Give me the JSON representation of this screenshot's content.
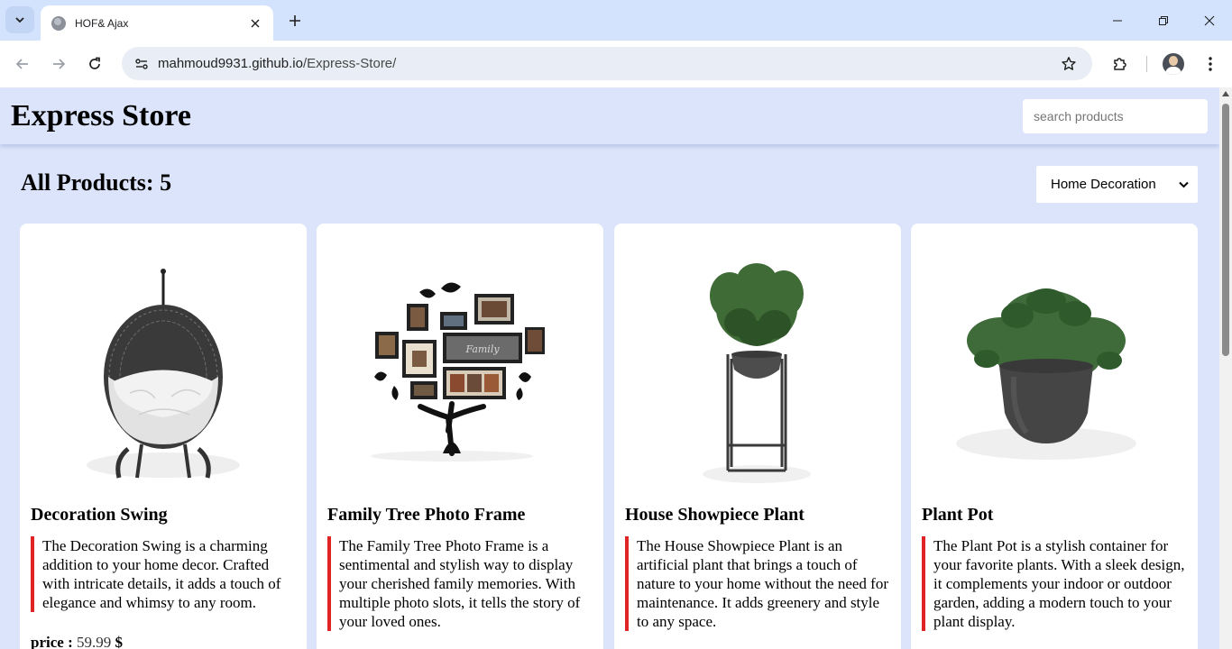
{
  "browser": {
    "tab": {
      "title": "HOF& Ajax"
    },
    "url": {
      "domain": "mahmoud9931.github.io",
      "path": "/Express-Store/"
    }
  },
  "header": {
    "title": "Express Store",
    "search_placeholder": "search products"
  },
  "products_section": {
    "heading": "All Products: 5",
    "filter_selected": "Home Decoration"
  },
  "products": [
    {
      "title": "Decoration Swing",
      "image_icon": "swing-chair-image",
      "description": "The Decoration Swing is a charming addition to your home decor. Crafted with intricate details, it adds a touch of elegance and whimsy to any room.",
      "price_label": "price :",
      "price_value": "59.99",
      "currency": "$"
    },
    {
      "title": "Family Tree Photo Frame",
      "image_icon": "family-tree-frame-image",
      "description": "The Family Tree Photo Frame is a sentimental and stylish way to display your cherished family memories. With multiple photo slots, it tells the story of your loved ones."
    },
    {
      "title": "House Showpiece Plant",
      "image_icon": "showpiece-plant-image",
      "description": "The House Showpiece Plant is an artificial plant that brings a touch of nature to your home without the need for maintenance. It adds greenery and style to any space."
    },
    {
      "title": "Plant Pot",
      "image_icon": "plant-pot-image",
      "description": "The Plant Pot is a stylish container for your favorite plants. With a sleek design, it complements your indoor or outdoor garden, adding a modern touch to your plant display."
    }
  ],
  "colors": {
    "page_bg": "#dbe4fa",
    "accent_border": "#e02424",
    "tabstrip_bg": "#d3e3fd"
  }
}
